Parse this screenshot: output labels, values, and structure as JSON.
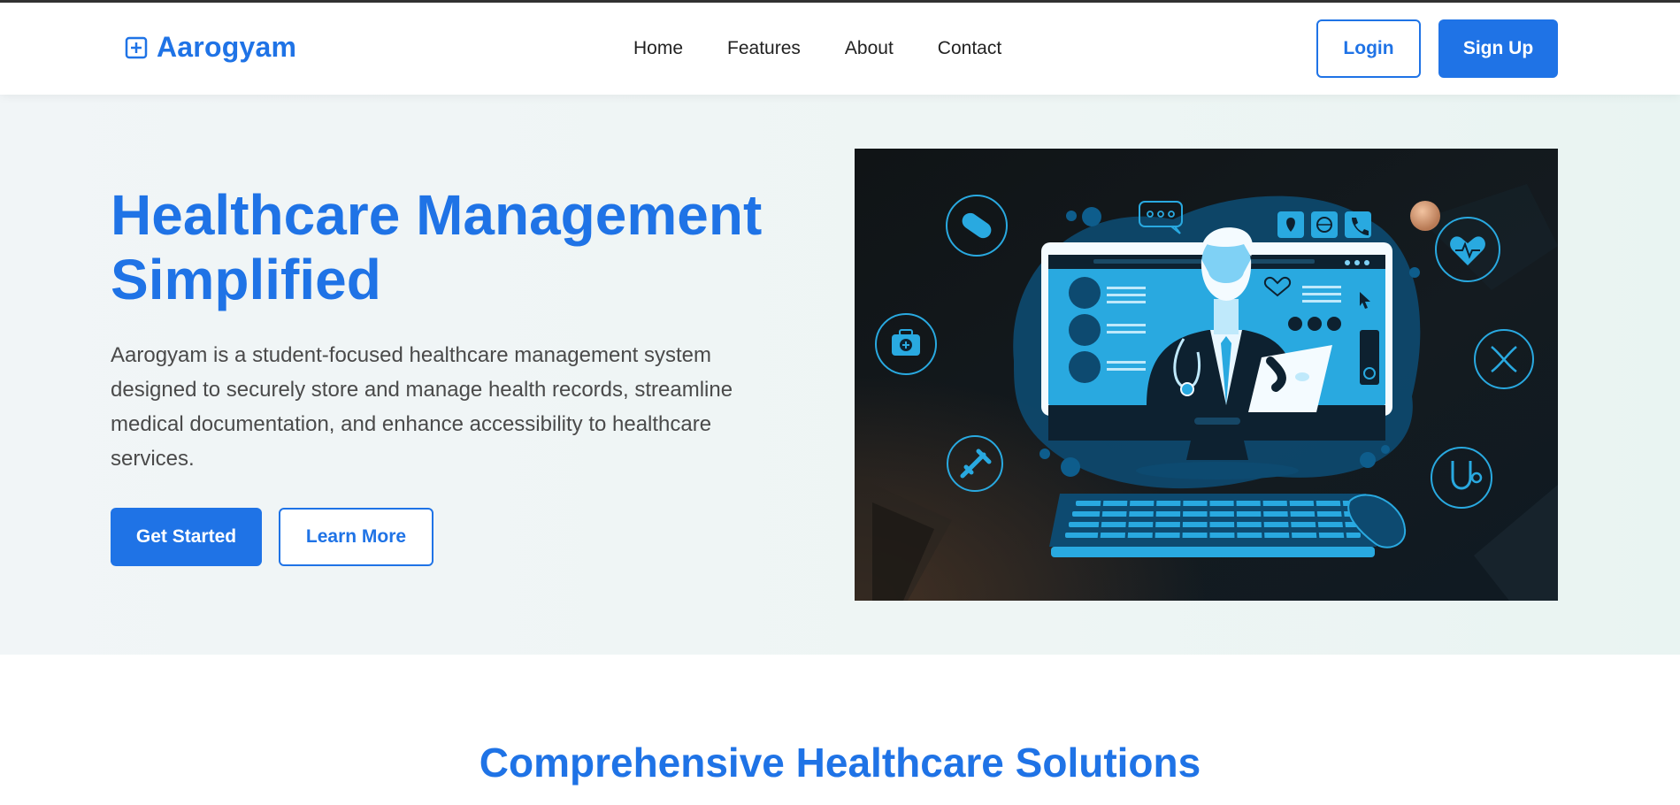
{
  "brand": {
    "name": "Aarogyam",
    "icon": "medical-plus-icon"
  },
  "nav": {
    "links": [
      "Home",
      "Features",
      "About",
      "Contact"
    ]
  },
  "auth": {
    "login_label": "Login",
    "signup_label": "Sign Up"
  },
  "hero": {
    "title_line1": "Healthcare Management",
    "title_line2": "Simplified",
    "description": "Aarogyam is a student-focused healthcare management system designed to securely store and manage health records, streamline medical documentation, and enhance accessibility to healthcare services.",
    "primary_cta": "Get Started",
    "secondary_cta": "Learn More",
    "illustration": "doctor-telemedicine-illustration"
  },
  "solutions": {
    "title": "Comprehensive Healthcare Solutions"
  },
  "colors": {
    "accent": "#1f73e6",
    "hero_bg": "#eef5f4",
    "illustration_bg": "#121a1f",
    "illustration_accent": "#29a9e0"
  }
}
